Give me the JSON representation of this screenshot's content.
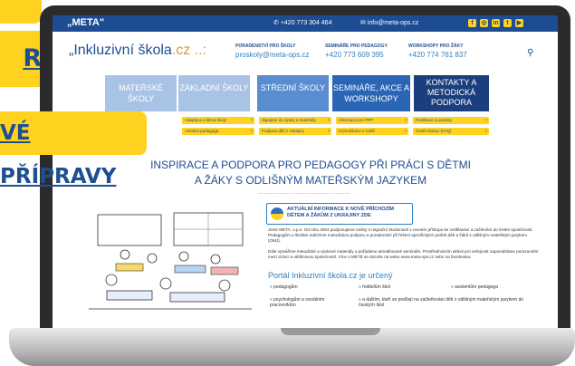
{
  "promo": {
    "tag2_text": "RA",
    "tag3_text": "VÉ PŘÍPRAVY"
  },
  "topbar": {
    "logo": "„META\"",
    "phone": "+420 773 304 464",
    "email": "info@meta-ops.cz",
    "social_icons": [
      "facebook-icon",
      "instagram-icon",
      "linkedin-icon",
      "twitter-icon",
      "youtube-icon"
    ]
  },
  "header": {
    "brand_main": "„Inkluzivní škola",
    "brand_tld": ".cz",
    "brand_dots": "..:",
    "info": [
      {
        "label": "PORADENSTVÍ PRO ŠKOLY",
        "value": "proskoly@meta-ops.cz"
      },
      {
        "label": "SEMINÁŘE PRO PEDAGOGY",
        "value": "+420 773 609 395"
      },
      {
        "label": "WORKSHOPY PRO ŽÁKY",
        "value": "+420 774 761 837"
      }
    ]
  },
  "nav": {
    "materske": "MATEŘSKÉ ŠKOLY",
    "zakladni": "ZÁKLADNÍ ŠKOLY",
    "stredni": "STŘEDNÍ ŠKOLY",
    "seminare": "SEMINÁŘE, AKCE A WORKSHOPY",
    "kontakty": "KONTAKTY A METODICKÁ PODPORA"
  },
  "submenu": [
    "Adaptace a klima školy",
    "Asistent pedagoga",
    "Zapojení do výuky a materiály",
    "Podpora dětí z Ukrajiny",
    "Informace pro PPP",
    "Komunikace s rodiči",
    "Publikace a postoky",
    "Časté dotazy (FAQ)"
  ],
  "hero": {
    "line1": "INSPIRACE A PODPORA PRO PEDAGOGY PŘI PRÁCI S DĚTMI",
    "line2": "A ŽÁKY S ODLIŠNÝM MATEŘSKÝM JAZYKEM"
  },
  "ukraine_box": "AKTUÁLNÍ INFORMACE K NOVĚ PŘÍCHOZÍM DĚTEM A ŽÁKŮM Z UKRAJINY ZDE",
  "para1": "Jsme META, o.p.s. Od roku 2004 podporujeme rodiny s migrační zkušeností v rovném přístupu ke vzdělávání a začlenění do české společnosti. Pedagogům a školám nabízíme metodickou podporu a poradenství při řešení specifických potřeb dětí a žáků s odlišným mateřským jazykem (OMJ).",
  "para2": "Dále vytváříme metodické a výukové materiály a pořádáme akreditované semináře. Prostřednictvím aktivit pro veřejnost napomáháme porozumění mezi cizinci a většinovou společností. Více o METĚ se dozvíte na webu www.meta-ops.cz nebo na facebooku.",
  "portal_title": "Portál Inkluzivní škola.cz je určený",
  "audience": [
    "pedagogům",
    "ředitelům škol",
    "asistentům pedagoga",
    "psychologům a sociálním pracovníkům",
    "a dalším, kteří se podílejí na začleňování dětí s odlišným mateřským jazykem do českých škol"
  ],
  "colors": {
    "yellow": "#ffd21f",
    "navy": "#1e4c92",
    "light_blue": "#a9c3e6"
  }
}
